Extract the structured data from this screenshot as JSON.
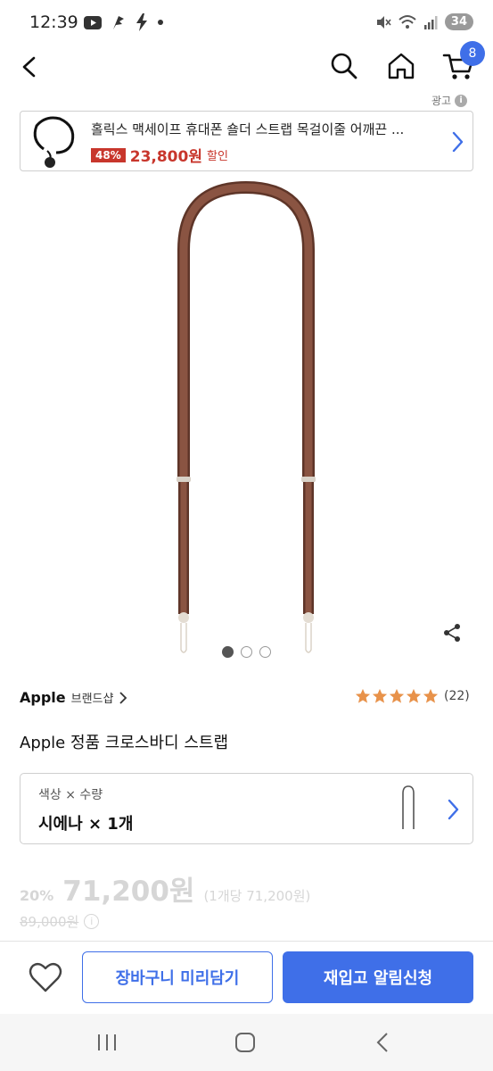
{
  "status_bar": {
    "time": "12:39",
    "battery": "34",
    "left_icons": [
      "youtube-icon",
      "bird-icon",
      "bolt-icon",
      "dot-icon"
    ],
    "right_icons": [
      "mute-icon",
      "wifi-icon",
      "signal-icon"
    ]
  },
  "header": {
    "cart_count": "8",
    "icons": [
      "back-arrow-icon",
      "search-icon",
      "home-icon",
      "cart-icon"
    ]
  },
  "ad": {
    "label": "광고",
    "title": "홀릭스 맥세이프 휴대폰 숄더 스트랩 목걸이줄 어깨끈 ...",
    "discount": "48%",
    "price": "23,800원",
    "sale_label": "할인"
  },
  "product": {
    "brand": "Apple",
    "brand_shop": "브랜드샵",
    "rating_stars": 5,
    "review_count": "(22)",
    "title": "Apple 정품 크로스바디 스트랩",
    "image_pages": 3,
    "image_active_page": 1
  },
  "option": {
    "label": "색상 × 수량",
    "value": "시에나 × 1개"
  },
  "price": {
    "discount": "20%",
    "amount": "71,200원",
    "unit_price": "(1개당 71,200원)",
    "original": "89,000원"
  },
  "bottom_bar": {
    "cart_label": "장바구니 미리담기",
    "restock_label": "재입고 알림신청"
  },
  "colors": {
    "accent": "#3f6fe8",
    "sale": "#c8362c",
    "strap": "#7a4a38",
    "star": "#e8924a"
  }
}
